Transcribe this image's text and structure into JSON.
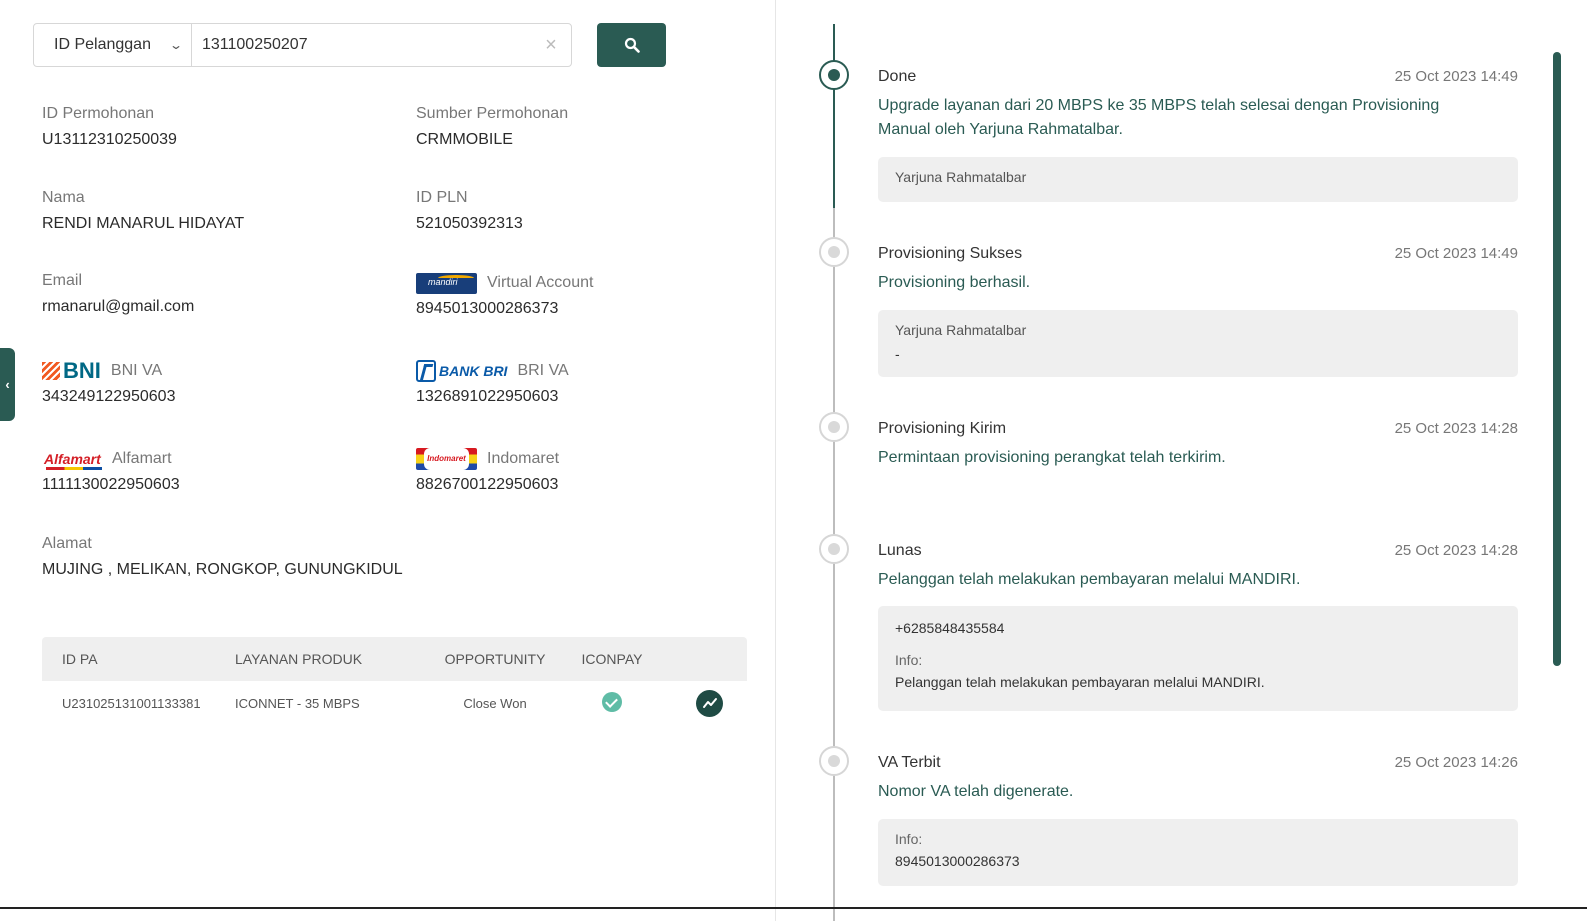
{
  "search": {
    "type_label": "ID Pelanggan",
    "value": "131100250207",
    "clear_glyph": "×"
  },
  "customer": {
    "id_permohonan_label": "ID Permohonan",
    "id_permohonan": "U13112310250039",
    "sumber_label": "Sumber Permohonan",
    "sumber": "CRMMOBILE",
    "nama_label": "Nama",
    "nama": "RENDI MANARUL HIDAYAT",
    "id_pln_label": "ID PLN",
    "id_pln": "521050392313",
    "email_label": "Email",
    "email": "rmanarul@gmail.com",
    "va_label": "Virtual Account",
    "va_bank_logo_text": "mandiri",
    "va": "8945013000286373",
    "bni_logo_text": "BNI",
    "bni_label": "BNI VA",
    "bni_va": "343249122950603",
    "bri_logo_text": "BANK BRI",
    "bri_label": "BRI VA",
    "bri_va": "1326891022950603",
    "alfa_logo_text": "Alfamart",
    "alfa_label": "Alfamart",
    "alfa_va": "1111130022950603",
    "indo_logo_text": "Indomaret",
    "indo_label": "Indomaret",
    "indo_va": "8826700122950603",
    "alamat_label": "Alamat",
    "alamat": "MUJING , MELIKAN, RONGKOP, GUNUNGKIDUL"
  },
  "table": {
    "headers": [
      "ID PA",
      "LAYANAN PRODUK",
      "OPPORTUNITY",
      "ICONPAY"
    ],
    "rows": [
      {
        "id_pa": "U231025131001133381",
        "layanan": "ICONNET - 35 MBPS",
        "opportunity": "Close Won",
        "iconpay": "check-icon"
      }
    ]
  },
  "timeline": [
    {
      "title": "Done",
      "time": "25 Oct 2023 14:49",
      "desc": "Upgrade layanan dari 20 MBPS ke 35 MBPS telah selesai dengan Provisioning Manual oleh Yarjuna Rahmatalbar.",
      "box_line1": "Yarjuna Rahmatalbar",
      "active": true
    },
    {
      "title": "Provisioning Sukses",
      "time": "25 Oct 2023 14:49",
      "desc": "Provisioning berhasil.",
      "box_line1": "Yarjuna Rahmatalbar",
      "box_line2": "-"
    },
    {
      "title": "Provisioning Kirim",
      "time": "25 Oct 2023 14:28",
      "desc": "Permintaan provisioning perangkat telah terkirim."
    },
    {
      "title": "Lunas",
      "time": "25 Oct 2023 14:28",
      "desc": "Pelanggan telah melakukan pembayaran melalui MANDIRI.",
      "box_line1": "+6285848435584",
      "box_info_label": "Info:",
      "box_info": "Pelanggan telah melakukan pembayaran melalui MANDIRI."
    },
    {
      "title": "VA Terbit",
      "time": "25 Oct 2023 14:26",
      "desc": "Nomor VA telah digenerate.",
      "box_info_label": "Info:",
      "box_info": "8945013000286373"
    }
  ],
  "colors": {
    "primary": "#2a5b53",
    "accent_text": "#2a5b53",
    "success": "#5fbca6"
  }
}
